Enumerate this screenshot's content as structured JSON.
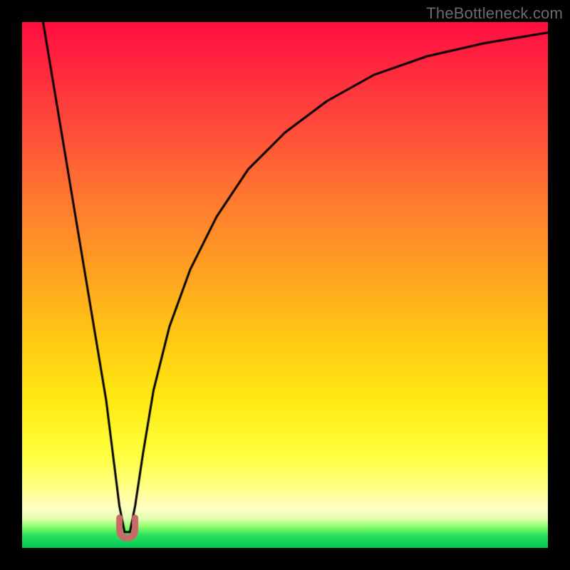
{
  "source_label": "TheBottleneck.com",
  "colors": {
    "frame": "#000000",
    "gradient_top": "#ff0d3f",
    "gradient_mid1": "#ff7a2f",
    "gradient_mid2": "#ffea12",
    "gradient_bottom_band": "#00c853",
    "curve": "#000000",
    "marker": "#c96a69"
  },
  "chart_data": {
    "type": "line",
    "title": "",
    "xlabel": "",
    "ylabel": "",
    "xlim": [
      0,
      100
    ],
    "ylim": [
      0,
      100
    ],
    "grid": false,
    "legend": false,
    "series": [
      {
        "name": "bottleneck-curve",
        "x": [
          4,
          6,
          8,
          10,
          12,
          14,
          16,
          17.5,
          18.5,
          19.5,
          20.5,
          21.5,
          23,
          25,
          28,
          32,
          37,
          43,
          50,
          58,
          67,
          77,
          88,
          100
        ],
        "y": [
          100,
          88,
          76,
          64,
          52,
          40,
          28,
          16,
          8,
          3,
          3,
          8,
          18,
          30,
          42,
          53,
          63,
          72,
          79,
          85,
          90,
          93.5,
          96,
          98
        ]
      }
    ],
    "marker": {
      "name": "dip-marker",
      "shape": "u",
      "x": 20,
      "y": 3,
      "color": "#c96a69"
    },
    "note": "Values estimated visually from the plot; axes have no tick labels."
  }
}
